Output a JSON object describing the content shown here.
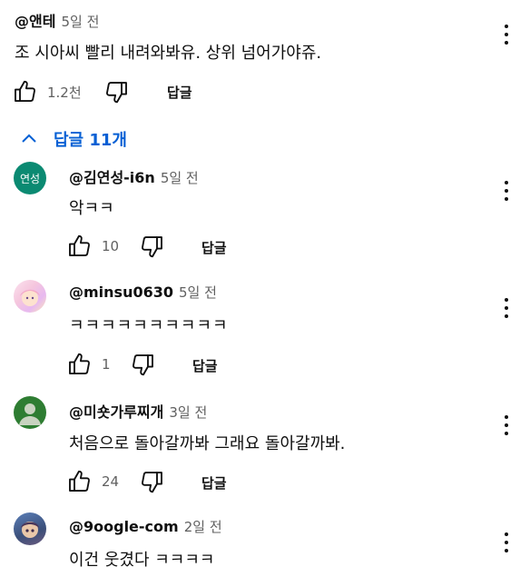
{
  "comment": {
    "author": "@앤테",
    "time": "5일 전",
    "text": "조 시아씨 빨리 내려와봐유. 상위 넘어가야쥬.",
    "likes": "1.2천",
    "reply_label": "답글"
  },
  "replies_toggle": {
    "label": "답글 11개",
    "icon": "chevron-up-icon"
  },
  "replies": [
    {
      "author": "@김연성-i6n",
      "time": "5일 전",
      "text": "악ㅋㅋ",
      "likes": "10",
      "reply_label": "답글",
      "avatar_text": "연성",
      "avatar_color": "#0b8a72"
    },
    {
      "author": "@minsu0630",
      "time": "5일 전",
      "text": "ㅋㅋㅋㅋㅋㅋㅋㅋㅋㅋ",
      "likes": "1",
      "reply_label": "답글"
    },
    {
      "author": "@미숏가루찌개",
      "time": "3일 전",
      "text": "처음으로 돌아갈까봐 그래요 돌아갈까봐.",
      "likes": "24",
      "reply_label": "답글",
      "avatar_color": "#2e7d32"
    },
    {
      "author": "@9oogle-com",
      "time": "2일 전",
      "text": "이건 웃겼다 ㅋㅋㅋㅋ"
    }
  ],
  "colors": {
    "link": "#065fd4",
    "text": "#0f0f0f",
    "secondary": "#606060"
  }
}
